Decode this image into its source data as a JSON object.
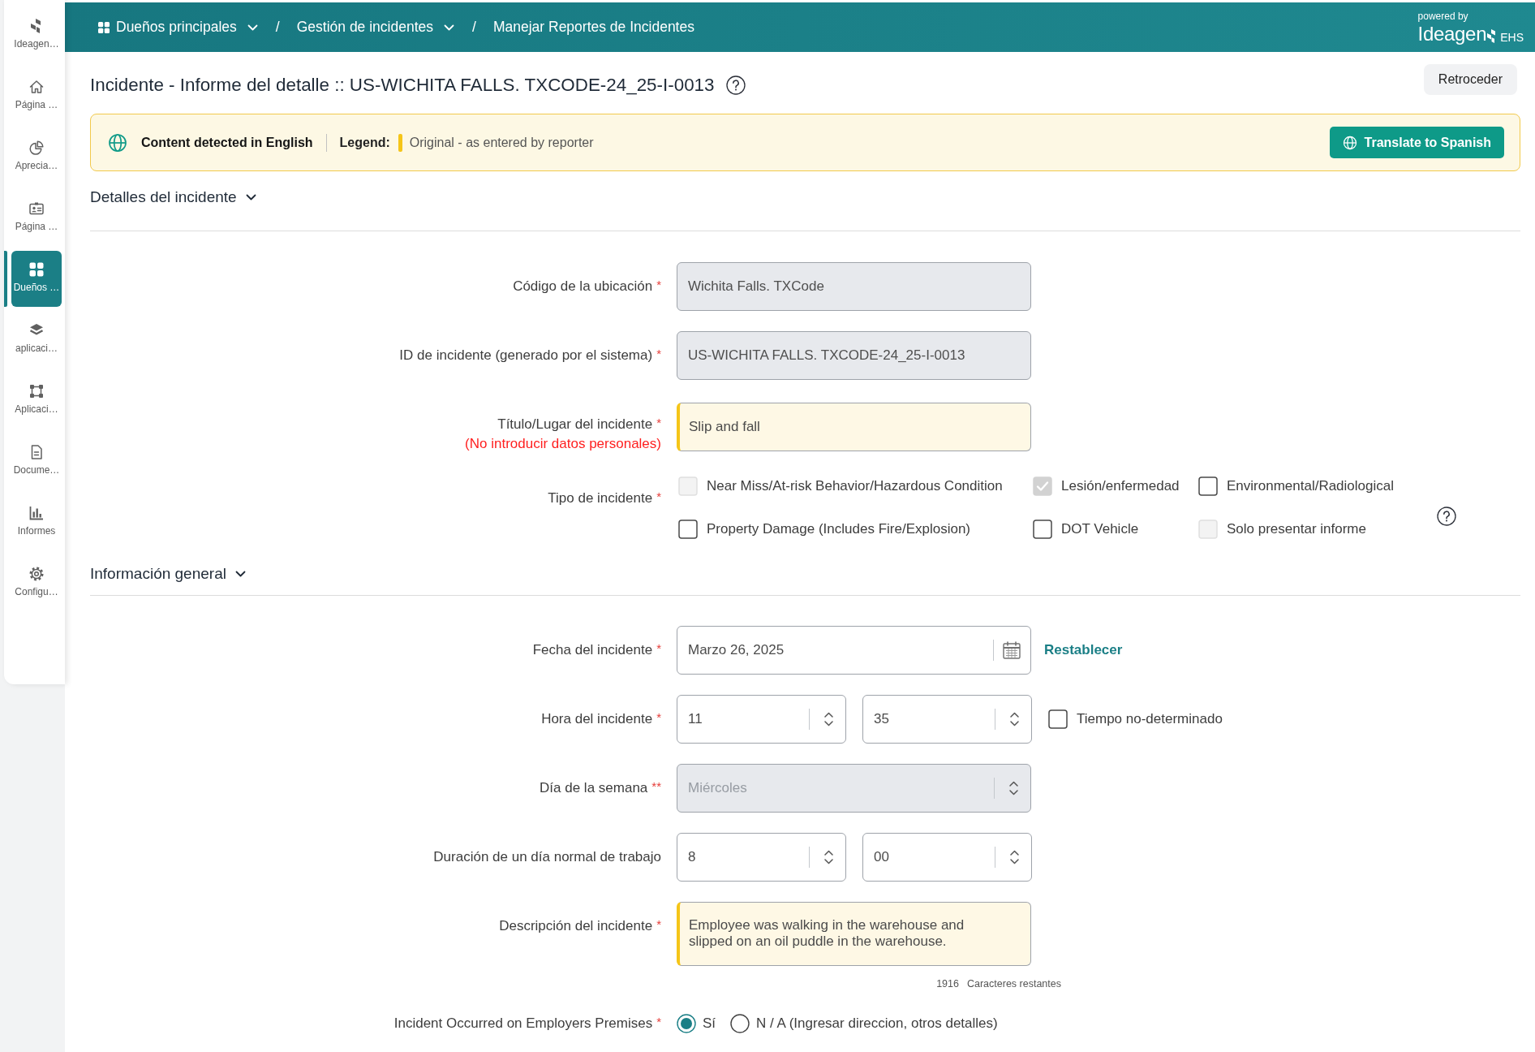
{
  "sidebar": {
    "items": [
      {
        "label": "Ideagen…",
        "selected": false
      },
      {
        "label": "Página …",
        "selected": false
      },
      {
        "label": "Aprecia…",
        "selected": false
      },
      {
        "label": "Página …",
        "selected": false
      },
      {
        "label": "Dueños …",
        "selected": true
      },
      {
        "label": "aplicaci…",
        "selected": false
      },
      {
        "label": "Aplicaci…",
        "selected": false
      },
      {
        "label": "Docume…",
        "selected": false
      },
      {
        "label": "Informes",
        "selected": false
      },
      {
        "label": "Configu…",
        "selected": false
      }
    ]
  },
  "top_bar": {
    "breadcrumb": [
      {
        "label": "Dueños principales",
        "dropdown": true,
        "separator": "/"
      },
      {
        "label": "Gestión de incidentes",
        "dropdown": true,
        "separator": "/"
      },
      {
        "label": "Manejar Reportes de Incidentes",
        "dropdown": false
      }
    ],
    "powered_by": "powered by",
    "brand": "Ideagen",
    "product": "EHS"
  },
  "header": {
    "title": "Incidente - Informe del detalle :: US-WICHITA FALLS. TXCODE-24_25-I-0013",
    "help": true,
    "back_button": "Retroceder"
  },
  "translation_banner": {
    "detected": "Content detected in English",
    "legend_label": "Legend:",
    "legend_text": "Original - as entered by reporter",
    "button": "Translate to Spanish"
  },
  "sections": [
    {
      "title": "Detalles del incidente",
      "expanded": true,
      "fields": [
        {
          "kind": "text",
          "label": "Código de la ubicación",
          "required_mark": "*",
          "value": "Wichita Falls. TXCode",
          "disabled": true,
          "original": false
        },
        {
          "kind": "text",
          "label": "ID de incidente (generado por el sistema)",
          "required_mark": "*",
          "value": "US-WICHITA FALLS. TXCODE-24_25-I-0013",
          "disabled": true,
          "original": false
        },
        {
          "kind": "text",
          "label": "Título/Lugar del incidente",
          "required_mark": "*",
          "note": "(No introducir datos personales)",
          "value": "Slip and fall",
          "disabled": false,
          "original": true
        },
        {
          "kind": "checkboxes",
          "label": "Tipo de incidente",
          "required_mark": "*",
          "help": true,
          "options": [
            {
              "label": "Near Miss/At-risk Behavior/Hazardous Condition",
              "checked": false,
              "disabled": true
            },
            {
              "label": "Lesión/enfermedad",
              "checked": true,
              "disabled": true
            },
            {
              "label": "Environmental/Radiological",
              "checked": false,
              "disabled": false
            },
            {
              "label": "Property Damage (Includes Fire/Explosion)",
              "checked": false,
              "disabled": false
            },
            {
              "label": "DOT Vehicle",
              "checked": false,
              "disabled": false
            },
            {
              "label": "Solo presentar informe",
              "checked": false,
              "disabled": true
            }
          ]
        }
      ]
    },
    {
      "title": "Información general",
      "expanded": true,
      "fields": [
        {
          "kind": "date",
          "label": "Fecha del incidente",
          "required_mark": "*",
          "value": "Marzo 26, 2025",
          "reset_link": "Restablecer"
        },
        {
          "kind": "spinners",
          "label": "Hora del incidente",
          "required_mark": "*",
          "values": [
            "11",
            "35"
          ],
          "checkbox": {
            "label": "Tiempo no-determinado",
            "checked": false
          }
        },
        {
          "kind": "select",
          "label": "Día de la semana",
          "required_mark": "**",
          "value": "Miércoles",
          "disabled": true
        },
        {
          "kind": "spinners",
          "label": "Duración de un día normal de trabajo",
          "values": [
            "8",
            "00"
          ]
        },
        {
          "kind": "textarea",
          "label": "Descripción del incidente",
          "required_mark": "*",
          "value": "Employee was walking in the warehouse and slipped on an oil puddle in the warehouse.",
          "original": true,
          "remaining_count": "1916",
          "remaining_label": "Caracteres restantes"
        },
        {
          "kind": "radio",
          "label": "Incident Occurred on Employers Premises",
          "required_mark": "*",
          "options": [
            {
              "label": "Sí",
              "selected": true
            },
            {
              "label": "N / A (Ingresar direccion, otros detalles)",
              "selected": false
            }
          ]
        }
      ]
    }
  ]
}
